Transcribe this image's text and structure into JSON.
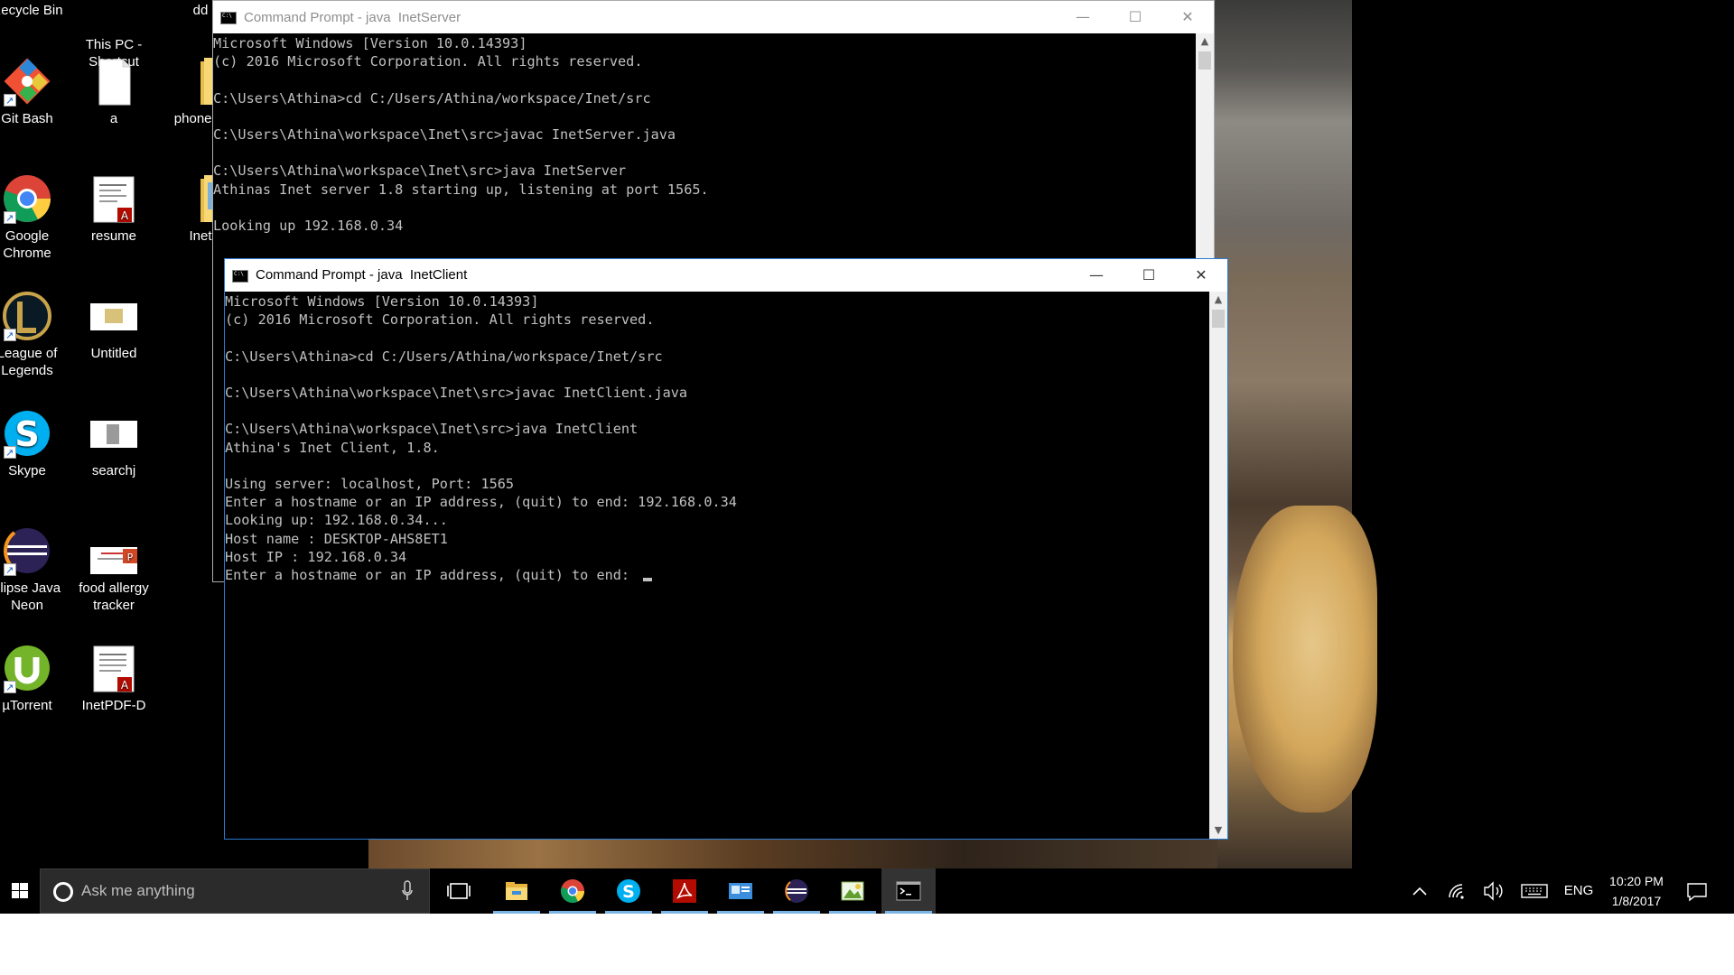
{
  "desktop": {
    "icons": [
      {
        "label": "Recycle Bin",
        "icon": "recycle-bin-icon"
      },
      {
        "label": "This PC -\nShortcut",
        "icon": "this-pc-icon"
      },
      {
        "label": "dd",
        "icon": "folder-icon"
      },
      {
        "label": "Git Bash",
        "icon": "git-bash-icon"
      },
      {
        "label": "a",
        "icon": "text-file-icon"
      },
      {
        "label": "phonebo",
        "icon": "folder-icon"
      },
      {
        "label": "Google\nChrome",
        "icon": "chrome-icon"
      },
      {
        "label": "resume",
        "icon": "pdf-file-icon"
      },
      {
        "label": "Inet",
        "icon": "folder-icon"
      },
      {
        "label": "League of\nLegends",
        "icon": "league-of-legends-icon"
      },
      {
        "label": "Untitled",
        "icon": "image-file-icon"
      },
      {
        "label": "Skype",
        "icon": "skype-icon"
      },
      {
        "label": "searchj",
        "icon": "image-file-icon"
      },
      {
        "label": "clipse Java\nNeon",
        "icon": "eclipse-icon"
      },
      {
        "label": "food allergy\ntracker",
        "icon": "powerpoint-file-icon"
      },
      {
        "label": "µTorrent",
        "icon": "utorrent-icon"
      },
      {
        "label": "InetPDF-D",
        "icon": "pdf-file-icon"
      }
    ]
  },
  "server_window": {
    "title": "Command Prompt - java  InetServer",
    "lines": [
      "Microsoft Windows [Version 10.0.14393]",
      "(c) 2016 Microsoft Corporation. All rights reserved.",
      "",
      "C:\\Users\\Athina>cd C:/Users/Athina/workspace/Inet/src",
      "",
      "C:\\Users\\Athina\\workspace\\Inet\\src>javac InetServer.java",
      "",
      "C:\\Users\\Athina\\workspace\\Inet\\src>java InetServer",
      "Athinas Inet server 1.8 starting up, listening at port 1565.",
      "",
      "Looking up 192.168.0.34"
    ]
  },
  "client_window": {
    "title": "Command Prompt - java  InetClient",
    "lines": [
      "Microsoft Windows [Version 10.0.14393]",
      "(c) 2016 Microsoft Corporation. All rights reserved.",
      "",
      "C:\\Users\\Athina>cd C:/Users/Athina/workspace/Inet/src",
      "",
      "C:\\Users\\Athina\\workspace\\Inet\\src>javac InetClient.java",
      "",
      "C:\\Users\\Athina\\workspace\\Inet\\src>java InetClient",
      "Athina's Inet Client, 1.8.",
      "",
      "Using server: localhost, Port: 1565",
      "Enter a hostname or an IP address, (quit) to end: 192.168.0.34",
      "Looking up: 192.168.0.34...",
      "Host name : DESKTOP-AHS8ET1",
      "Host IP : 192.168.0.34",
      "Enter a hostname or an IP address, (quit) to end: "
    ]
  },
  "window_controls": {
    "minimize": "—",
    "maximize": "☐",
    "close": "✕"
  },
  "taskbar": {
    "search_placeholder": "Ask me anything",
    "pinned": [
      {
        "icon": "file-explorer-icon",
        "running": true
      },
      {
        "icon": "chrome-icon",
        "running": true
      },
      {
        "icon": "skype-icon",
        "running": true
      },
      {
        "icon": "acrobat-icon",
        "running": true
      },
      {
        "icon": "outlook-card-icon",
        "running": true
      },
      {
        "icon": "eclipse-icon",
        "running": true
      },
      {
        "icon": "image-viewer-icon",
        "running": true
      },
      {
        "icon": "command-prompt-icon",
        "running": true,
        "active": true
      }
    ],
    "language": "ENG",
    "time": "10:20 PM",
    "date": "1/8/2017"
  },
  "colors": {
    "console_bg": "#000000",
    "console_text": "#c0c0c0",
    "window_border_active": "#2b7bd2",
    "taskbar_bg": "#000000",
    "taskbar_running_indicator": "#7ab3e6"
  }
}
